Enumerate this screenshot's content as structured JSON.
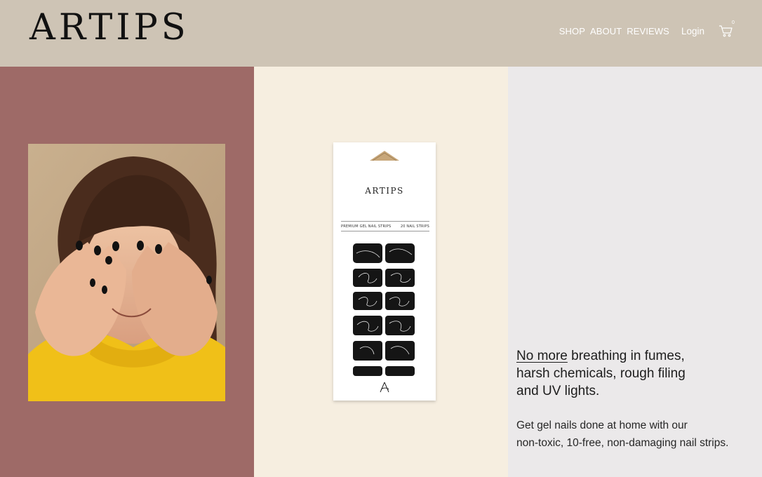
{
  "brand": {
    "logo": "ARTIPS"
  },
  "nav": {
    "items": [
      {
        "label": "SHOP"
      },
      {
        "label": "ABOUT"
      },
      {
        "label": "REVIEWS"
      }
    ],
    "login": "Login",
    "cart_icon": "cart-icon",
    "cart_count": "0"
  },
  "panels": {
    "left_color": "#9e6a67",
    "mid_color": "#f6eee0",
    "right_color": "#ebe9ea"
  },
  "product": {
    "pack_logo": "ARTIPS",
    "label_left": "PREMIUM GEL NAIL STRIPS",
    "label_right": "20 NAIL STRIPS"
  },
  "hero": {
    "headline_emphasis": "No more",
    "headline_line1_rest": " breathing in fumes,",
    "headline_line2": "harsh chemicals, rough filing",
    "headline_line3": "and UV lights.",
    "sub_line1": "Get gel nails done at home with our",
    "sub_line2": "non-toxic, 10-free, non-damaging nail strips."
  }
}
